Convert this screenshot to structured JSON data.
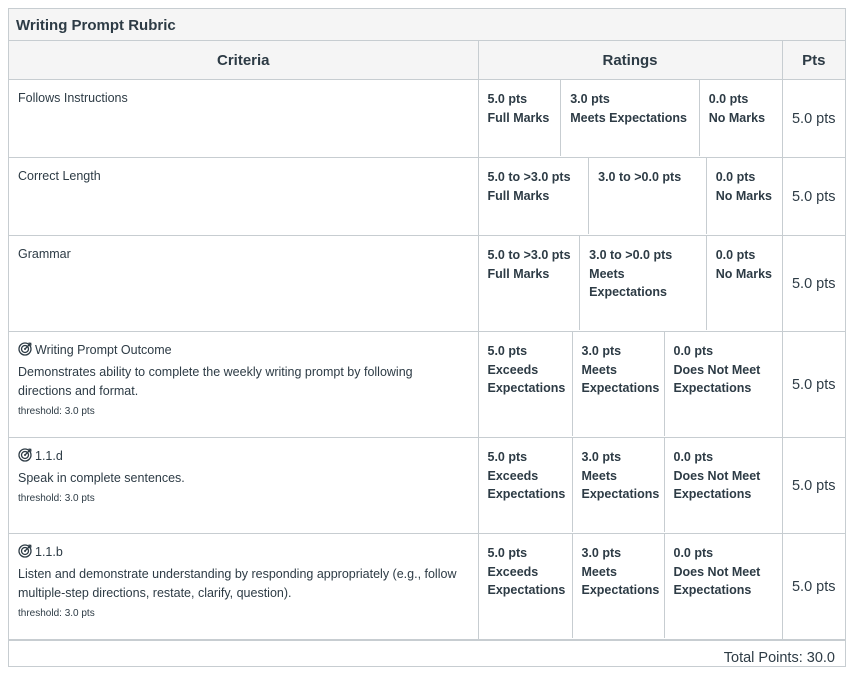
{
  "rubric": {
    "title": "Writing Prompt Rubric",
    "headers": {
      "criteria": "Criteria",
      "ratings": "Ratings",
      "pts": "Pts"
    },
    "rows": [
      {
        "title": "Follows Instructions",
        "ratings": [
          {
            "pts": "5.0 pts",
            "desc": "Full Marks"
          },
          {
            "pts": "3.0 pts",
            "desc": "Meets Expectations"
          },
          {
            "pts": "0.0 pts",
            "desc": "No Marks"
          }
        ],
        "points": "5.0 pts"
      },
      {
        "title": "Correct Length",
        "ratings": [
          {
            "pts": "5.0 to >3.0 pts",
            "desc": "Full Marks"
          },
          {
            "pts": "3.0 to >0.0 pts",
            "desc": ""
          },
          {
            "pts": "0.0 pts",
            "desc": "No Marks"
          }
        ],
        "points": "5.0 pts"
      },
      {
        "title": "Grammar",
        "ratings": [
          {
            "pts": "5.0 to >3.0 pts",
            "desc": "Full Marks"
          },
          {
            "pts": "3.0 to >0.0 pts",
            "desc": "Meets Expectations"
          },
          {
            "pts": "0.0 pts",
            "desc": "No Marks"
          }
        ],
        "points": "5.0 pts"
      },
      {
        "title": "Writing Prompt Outcome",
        "description": "Demonstrates ability to complete the weekly writing prompt by following directions and format.",
        "threshold": "threshold: 3.0 pts",
        "icon": "outcome-target-icon",
        "ratings": [
          {
            "pts": "5.0 pts",
            "desc": "Exceeds Expectations"
          },
          {
            "pts": "3.0 pts",
            "desc": "Meets Expectations"
          },
          {
            "pts": "0.0 pts",
            "desc": "Does Not Meet Expectations"
          }
        ],
        "points": "5.0 pts"
      },
      {
        "title": "1.1.d",
        "description": "Speak in complete sentences.",
        "threshold": "threshold: 3.0 pts",
        "icon": "outcome-target-icon",
        "ratings": [
          {
            "pts": "5.0 pts",
            "desc": "Exceeds Expectations"
          },
          {
            "pts": "3.0 pts",
            "desc": "Meets Expectations"
          },
          {
            "pts": "0.0 pts",
            "desc": "Does Not Meet Expectations"
          }
        ],
        "points": "5.0 pts"
      },
      {
        "title": "1.1.b",
        "description": "Listen and demonstrate understanding by responding appropriately (e.g., follow multiple-step directions, restate, clarify, question).",
        "threshold": "threshold: 3.0 pts",
        "icon": "outcome-target-icon",
        "ratings": [
          {
            "pts": "5.0 pts",
            "desc": "Exceeds Expectations"
          },
          {
            "pts": "3.0 pts",
            "desc": "Meets Expectations"
          },
          {
            "pts": "0.0 pts",
            "desc": "Does Not Meet Expectations"
          }
        ],
        "points": "5.0 pts"
      }
    ],
    "total": "Total Points: 30.0"
  }
}
